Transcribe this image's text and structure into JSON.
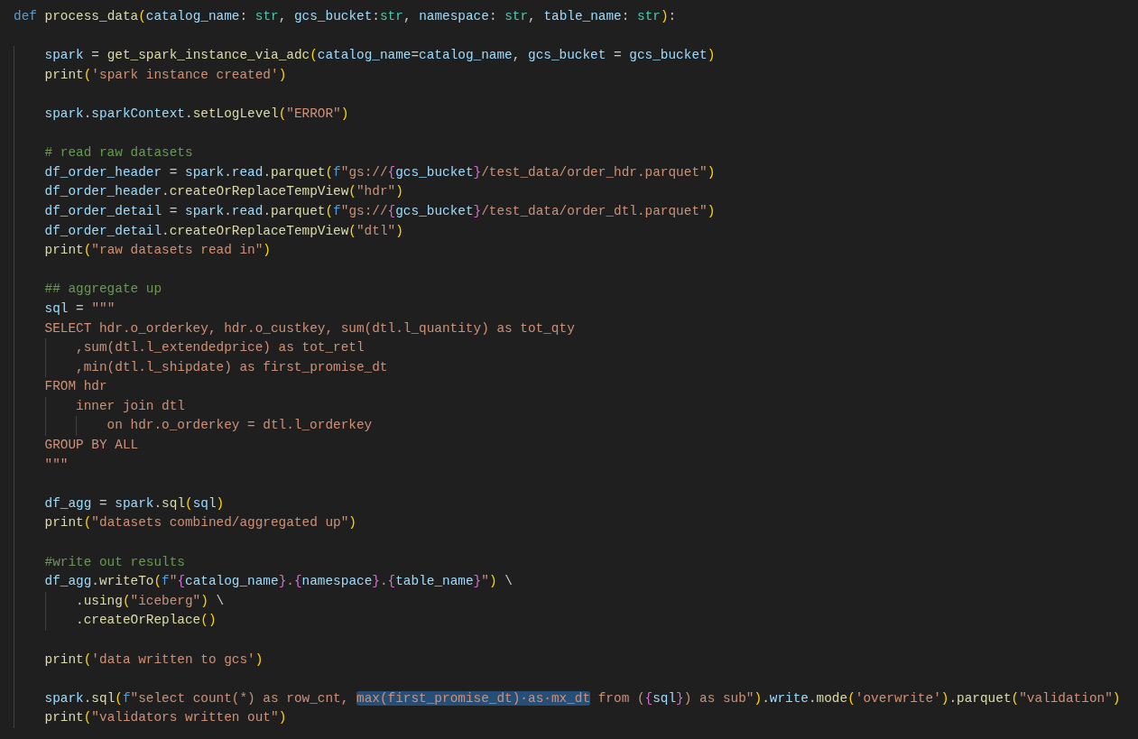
{
  "editor": {
    "lines": [
      {
        "kind": "code",
        "tokens": [
          {
            "kind": "kw",
            "text": "def "
          },
          {
            "kind": "fn",
            "text": "process_data"
          },
          {
            "kind": "b1",
            "text": "("
          },
          {
            "kind": "var",
            "text": "catalog_name"
          },
          {
            "kind": "p",
            "text": ": "
          },
          {
            "kind": "type",
            "text": "str"
          },
          {
            "kind": "p",
            "text": ", "
          },
          {
            "kind": "var",
            "text": "gcs_bucket"
          },
          {
            "kind": "p",
            "text": ":"
          },
          {
            "kind": "type",
            "text": "str"
          },
          {
            "kind": "p",
            "text": ", "
          },
          {
            "kind": "var",
            "text": "namespace"
          },
          {
            "kind": "p",
            "text": ": "
          },
          {
            "kind": "type",
            "text": "str"
          },
          {
            "kind": "p",
            "text": ", "
          },
          {
            "kind": "var",
            "text": "table_name"
          },
          {
            "kind": "p",
            "text": ": "
          },
          {
            "kind": "type",
            "text": "str"
          },
          {
            "kind": "b1",
            "text": ")"
          },
          {
            "kind": "p",
            "text": ":"
          }
        ]
      },
      {
        "kind": "blank"
      },
      {
        "kind": "code",
        "tokens": [
          {
            "kind": "var",
            "text": "    spark"
          },
          {
            "kind": "p",
            "text": " = "
          },
          {
            "kind": "fn",
            "text": "get_spark_instance_via_adc"
          },
          {
            "kind": "b1",
            "text": "("
          },
          {
            "kind": "var",
            "text": "catalog_name"
          },
          {
            "kind": "p",
            "text": "="
          },
          {
            "kind": "var",
            "text": "catalog_name"
          },
          {
            "kind": "p",
            "text": ", "
          },
          {
            "kind": "var",
            "text": "gcs_bucket"
          },
          {
            "kind": "p",
            "text": " = "
          },
          {
            "kind": "var",
            "text": "gcs_bucket"
          },
          {
            "kind": "b1",
            "text": ")"
          }
        ]
      },
      {
        "kind": "code",
        "tokens": [
          {
            "kind": "fn",
            "text": "    print"
          },
          {
            "kind": "b1",
            "text": "("
          },
          {
            "kind": "str",
            "text": "'spark instance created'"
          },
          {
            "kind": "b1",
            "text": ")"
          }
        ]
      },
      {
        "kind": "blank"
      },
      {
        "kind": "code",
        "tokens": [
          {
            "kind": "var",
            "text": "    spark"
          },
          {
            "kind": "p",
            "text": "."
          },
          {
            "kind": "var",
            "text": "sparkContext"
          },
          {
            "kind": "p",
            "text": "."
          },
          {
            "kind": "fn",
            "text": "setLogLevel"
          },
          {
            "kind": "b1",
            "text": "("
          },
          {
            "kind": "str",
            "text": "\"ERROR\""
          },
          {
            "kind": "b1",
            "text": ")"
          }
        ]
      },
      {
        "kind": "blank"
      },
      {
        "kind": "code",
        "tokens": [
          {
            "kind": "cmt",
            "text": "    # read raw datasets"
          }
        ]
      },
      {
        "kind": "code",
        "tokens": [
          {
            "kind": "var",
            "text": "    df_order_header"
          },
          {
            "kind": "p",
            "text": " = "
          },
          {
            "kind": "var",
            "text": "spark"
          },
          {
            "kind": "p",
            "text": "."
          },
          {
            "kind": "var",
            "text": "read"
          },
          {
            "kind": "p",
            "text": "."
          },
          {
            "kind": "fn",
            "text": "parquet"
          },
          {
            "kind": "b1",
            "text": "("
          },
          {
            "kind": "kw",
            "text": "f"
          },
          {
            "kind": "str",
            "text": "\"gs://"
          },
          {
            "kind": "b2",
            "text": "{"
          },
          {
            "kind": "var",
            "text": "gcs_bucket"
          },
          {
            "kind": "b2",
            "text": "}"
          },
          {
            "kind": "str",
            "text": "/test_data/order_hdr.parquet\""
          },
          {
            "kind": "b1",
            "text": ")"
          }
        ]
      },
      {
        "kind": "code",
        "tokens": [
          {
            "kind": "var",
            "text": "    df_order_header"
          },
          {
            "kind": "p",
            "text": "."
          },
          {
            "kind": "fn",
            "text": "createOrReplaceTempView"
          },
          {
            "kind": "b1",
            "text": "("
          },
          {
            "kind": "str",
            "text": "\"hdr\""
          },
          {
            "kind": "b1",
            "text": ")"
          }
        ]
      },
      {
        "kind": "code",
        "tokens": [
          {
            "kind": "var",
            "text": "    df_order_detail"
          },
          {
            "kind": "p",
            "text": " = "
          },
          {
            "kind": "var",
            "text": "spark"
          },
          {
            "kind": "p",
            "text": "."
          },
          {
            "kind": "var",
            "text": "read"
          },
          {
            "kind": "p",
            "text": "."
          },
          {
            "kind": "fn",
            "text": "parquet"
          },
          {
            "kind": "b1",
            "text": "("
          },
          {
            "kind": "kw",
            "text": "f"
          },
          {
            "kind": "str",
            "text": "\"gs://"
          },
          {
            "kind": "b2",
            "text": "{"
          },
          {
            "kind": "var",
            "text": "gcs_bucket"
          },
          {
            "kind": "b2",
            "text": "}"
          },
          {
            "kind": "str",
            "text": "/test_data/order_dtl.parquet\""
          },
          {
            "kind": "b1",
            "text": ")"
          }
        ]
      },
      {
        "kind": "code",
        "tokens": [
          {
            "kind": "var",
            "text": "    df_order_detail"
          },
          {
            "kind": "p",
            "text": "."
          },
          {
            "kind": "fn",
            "text": "createOrReplaceTempView"
          },
          {
            "kind": "b1",
            "text": "("
          },
          {
            "kind": "str",
            "text": "\"dtl\""
          },
          {
            "kind": "b1",
            "text": ")"
          }
        ]
      },
      {
        "kind": "code",
        "tokens": [
          {
            "kind": "fn",
            "text": "    print"
          },
          {
            "kind": "b1",
            "text": "("
          },
          {
            "kind": "str",
            "text": "\"raw datasets read in\""
          },
          {
            "kind": "b1",
            "text": ")"
          }
        ]
      },
      {
        "kind": "blank"
      },
      {
        "kind": "code",
        "tokens": [
          {
            "kind": "cmt",
            "text": "    ## aggregate up"
          }
        ]
      },
      {
        "kind": "code",
        "tokens": [
          {
            "kind": "var",
            "text": "    sql"
          },
          {
            "kind": "p",
            "text": " = "
          },
          {
            "kind": "str",
            "text": "\"\"\""
          }
        ]
      },
      {
        "kind": "code",
        "tokens": [
          {
            "kind": "str",
            "text": "    SELECT hdr.o_orderkey, hdr.o_custkey, sum(dtl.l_quantity) as tot_qty"
          }
        ]
      },
      {
        "kind": "code",
        "tokens": [
          {
            "kind": "str",
            "text": "        ,sum(dtl.l_extendedprice) as tot_retl"
          }
        ]
      },
      {
        "kind": "code",
        "tokens": [
          {
            "kind": "str",
            "text": "        ,min(dtl.l_shipdate) as first_promise_dt"
          }
        ]
      },
      {
        "kind": "code",
        "tokens": [
          {
            "kind": "str",
            "text": "    FROM hdr"
          }
        ]
      },
      {
        "kind": "code",
        "tokens": [
          {
            "kind": "str",
            "text": "        inner join dtl"
          }
        ]
      },
      {
        "kind": "code",
        "tokens": [
          {
            "kind": "str",
            "text": "            on hdr.o_orderkey = dtl.l_orderkey"
          }
        ]
      },
      {
        "kind": "code",
        "tokens": [
          {
            "kind": "str",
            "text": "    GROUP BY ALL"
          }
        ]
      },
      {
        "kind": "code",
        "tokens": [
          {
            "kind": "str",
            "text": "    \"\"\""
          }
        ]
      },
      {
        "kind": "blank"
      },
      {
        "kind": "code",
        "tokens": [
          {
            "kind": "var",
            "text": "    df_agg"
          },
          {
            "kind": "p",
            "text": " = "
          },
          {
            "kind": "var",
            "text": "spark"
          },
          {
            "kind": "p",
            "text": "."
          },
          {
            "kind": "fn",
            "text": "sql"
          },
          {
            "kind": "b1",
            "text": "("
          },
          {
            "kind": "var",
            "text": "sql"
          },
          {
            "kind": "b1",
            "text": ")"
          }
        ]
      },
      {
        "kind": "code",
        "tokens": [
          {
            "kind": "fn",
            "text": "    print"
          },
          {
            "kind": "b1",
            "text": "("
          },
          {
            "kind": "str",
            "text": "\"datasets combined/aggregated up\""
          },
          {
            "kind": "b1",
            "text": ")"
          }
        ]
      },
      {
        "kind": "blank"
      },
      {
        "kind": "code",
        "tokens": [
          {
            "kind": "cmt",
            "text": "    #write out results"
          }
        ]
      },
      {
        "kind": "code",
        "tokens": [
          {
            "kind": "var",
            "text": "    df_agg"
          },
          {
            "kind": "p",
            "text": "."
          },
          {
            "kind": "fn",
            "text": "writeTo"
          },
          {
            "kind": "b1",
            "text": "("
          },
          {
            "kind": "kw",
            "text": "f"
          },
          {
            "kind": "str",
            "text": "\""
          },
          {
            "kind": "b2",
            "text": "{"
          },
          {
            "kind": "var",
            "text": "catalog_name"
          },
          {
            "kind": "b2",
            "text": "}"
          },
          {
            "kind": "str",
            "text": "."
          },
          {
            "kind": "b2",
            "text": "{"
          },
          {
            "kind": "var",
            "text": "namespace"
          },
          {
            "kind": "b2",
            "text": "}"
          },
          {
            "kind": "str",
            "text": "."
          },
          {
            "kind": "b2",
            "text": "{"
          },
          {
            "kind": "var",
            "text": "table_name"
          },
          {
            "kind": "b2",
            "text": "}"
          },
          {
            "kind": "str",
            "text": "\""
          },
          {
            "kind": "b1",
            "text": ")"
          },
          {
            "kind": "p",
            "text": " \\"
          }
        ]
      },
      {
        "kind": "code",
        "tokens": [
          {
            "kind": "p",
            "text": "        ."
          },
          {
            "kind": "fn",
            "text": "using"
          },
          {
            "kind": "b1",
            "text": "("
          },
          {
            "kind": "str",
            "text": "\"iceberg\""
          },
          {
            "kind": "b1",
            "text": ")"
          },
          {
            "kind": "p",
            "text": " \\"
          }
        ]
      },
      {
        "kind": "code",
        "tokens": [
          {
            "kind": "p",
            "text": "        ."
          },
          {
            "kind": "fn",
            "text": "createOrReplace"
          },
          {
            "kind": "b1",
            "text": "()"
          }
        ]
      },
      {
        "kind": "blank"
      },
      {
        "kind": "code",
        "tokens": [
          {
            "kind": "fn",
            "text": "    print"
          },
          {
            "kind": "b1",
            "text": "("
          },
          {
            "kind": "str",
            "text": "'data written to gcs'"
          },
          {
            "kind": "b1",
            "text": ")"
          }
        ]
      },
      {
        "kind": "blank"
      },
      {
        "kind": "code",
        "tokens": [
          {
            "kind": "var",
            "text": "    spark"
          },
          {
            "kind": "p",
            "text": "."
          },
          {
            "kind": "fn",
            "text": "sql"
          },
          {
            "kind": "b1",
            "text": "("
          },
          {
            "kind": "kw",
            "text": "f"
          },
          {
            "kind": "str",
            "text": "\"select count(*) as row_cnt, "
          },
          {
            "kind": "sel",
            "text": "max(first_promise_dt)·as·mx_dt"
          },
          {
            "kind": "str",
            "text": " from ("
          },
          {
            "kind": "b2",
            "text": "{"
          },
          {
            "kind": "var",
            "text": "sql"
          },
          {
            "kind": "b2",
            "text": "}"
          },
          {
            "kind": "str",
            "text": ") as sub\""
          },
          {
            "kind": "b1",
            "text": ")"
          },
          {
            "kind": "p",
            "text": "."
          },
          {
            "kind": "var",
            "text": "write"
          },
          {
            "kind": "p",
            "text": "."
          },
          {
            "kind": "fn",
            "text": "mode"
          },
          {
            "kind": "b1",
            "text": "("
          },
          {
            "kind": "str",
            "text": "'overwrite'"
          },
          {
            "kind": "b1",
            "text": ")"
          },
          {
            "kind": "p",
            "text": "."
          },
          {
            "kind": "fn",
            "text": "parquet"
          },
          {
            "kind": "b1",
            "text": "("
          },
          {
            "kind": "str",
            "text": "\"validation\""
          },
          {
            "kind": "b1",
            "text": ")"
          }
        ]
      },
      {
        "kind": "code",
        "tokens": [
          {
            "kind": "fn",
            "text": "    print"
          },
          {
            "kind": "b1",
            "text": "("
          },
          {
            "kind": "str",
            "text": "\"validators written out\""
          },
          {
            "kind": "b1",
            "text": ")"
          }
        ]
      }
    ]
  }
}
